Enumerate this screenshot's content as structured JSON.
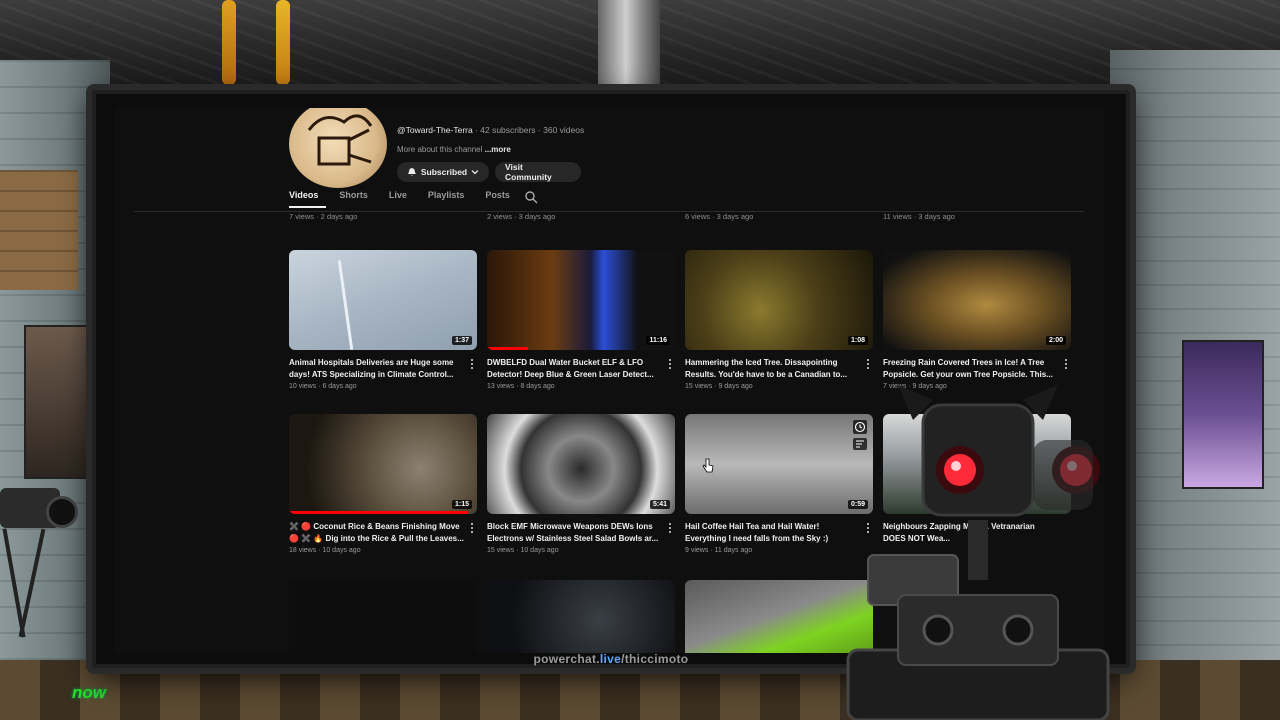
{
  "channel": {
    "handle": "@Toward-The-Terra",
    "meta": " · 42 subscribers · 360 videos",
    "about": "More about this channel",
    "about_more": "...more",
    "subscribed_label": "Subscribed",
    "community_label": "Visit Community"
  },
  "tabs": [
    {
      "label": "Videos"
    },
    {
      "label": "Shorts"
    },
    {
      "label": "Live"
    },
    {
      "label": "Playlists"
    },
    {
      "label": "Posts"
    }
  ],
  "top_row_meta": [
    "7 views · 2 days ago",
    "2 views · 3 days ago",
    "6 views · 3 days ago",
    "11 views · 3 days ago"
  ],
  "videos": [
    {
      "title": "Animal Hospitals Deliveries are Huge some days! ATS Specializing in Climate Control...",
      "meta": "10 views · 6 days ago",
      "duration": "1:37",
      "progress": 0
    },
    {
      "title": "DWBELFD Dual Water Bucket ELF & LFO Detector! Deep Blue & Green Laser Detect...",
      "meta": "13 views · 8 days ago",
      "duration": "11:16",
      "progress": 0.22
    },
    {
      "title": "Hammering the Iced Tree. Dissapointing Results. You'de have to be a Canadian to...",
      "meta": "15 views · 9 days ago",
      "duration": "1:08",
      "progress": 0
    },
    {
      "title": "Freezing Rain Covered Trees in Ice! A Tree Popsicle. Get your own Tree Popsicle. This...",
      "meta": "7 views · 9 days ago",
      "duration": "2:00",
      "progress": 0
    },
    {
      "title": "✖️ 🔴 Coconut Rice & Beans Finishing Move 🔴 ✖️ 🔥 Dig into the Rice & Pull the Leaves...",
      "meta": "18 views · 10 days ago",
      "duration": "1:15",
      "progress": 0.95
    },
    {
      "title": "Block EMF Microwave Weapons DEWs Ions Electrons w/ Stainless Steel Salad Bowls ar...",
      "meta": "15 views · 10 days ago",
      "duration": "5:41",
      "progress": 0
    },
    {
      "title": "Hail Coffee Hail Tea and Hail Water! Everything I need falls from the Sky :)",
      "meta": "9 views · 11 days ago",
      "duration": "0:59",
      "progress": 0
    },
    {
      "title": "Neighbours Zapping Me w... Vetranarian DOES NOT Wea...",
      "meta": "",
      "duration": "",
      "progress": 0
    },
    {
      "title": "",
      "meta": "",
      "duration": "",
      "progress": 0
    },
    {
      "title": "",
      "meta": "",
      "duration": "",
      "progress": 0
    },
    {
      "title": "",
      "meta": "",
      "duration": "",
      "progress": 0
    }
  ],
  "footer": {
    "prefix": "powerchat.",
    "highlight": "live",
    "suffix": "/thiccimoto"
  },
  "badge": "now",
  "colors": {
    "accent_red": "#ff0000",
    "powerchat_blue": "#5fa8ff",
    "robot_eye": "#ff2a3a",
    "now_green": "#29e02c"
  }
}
